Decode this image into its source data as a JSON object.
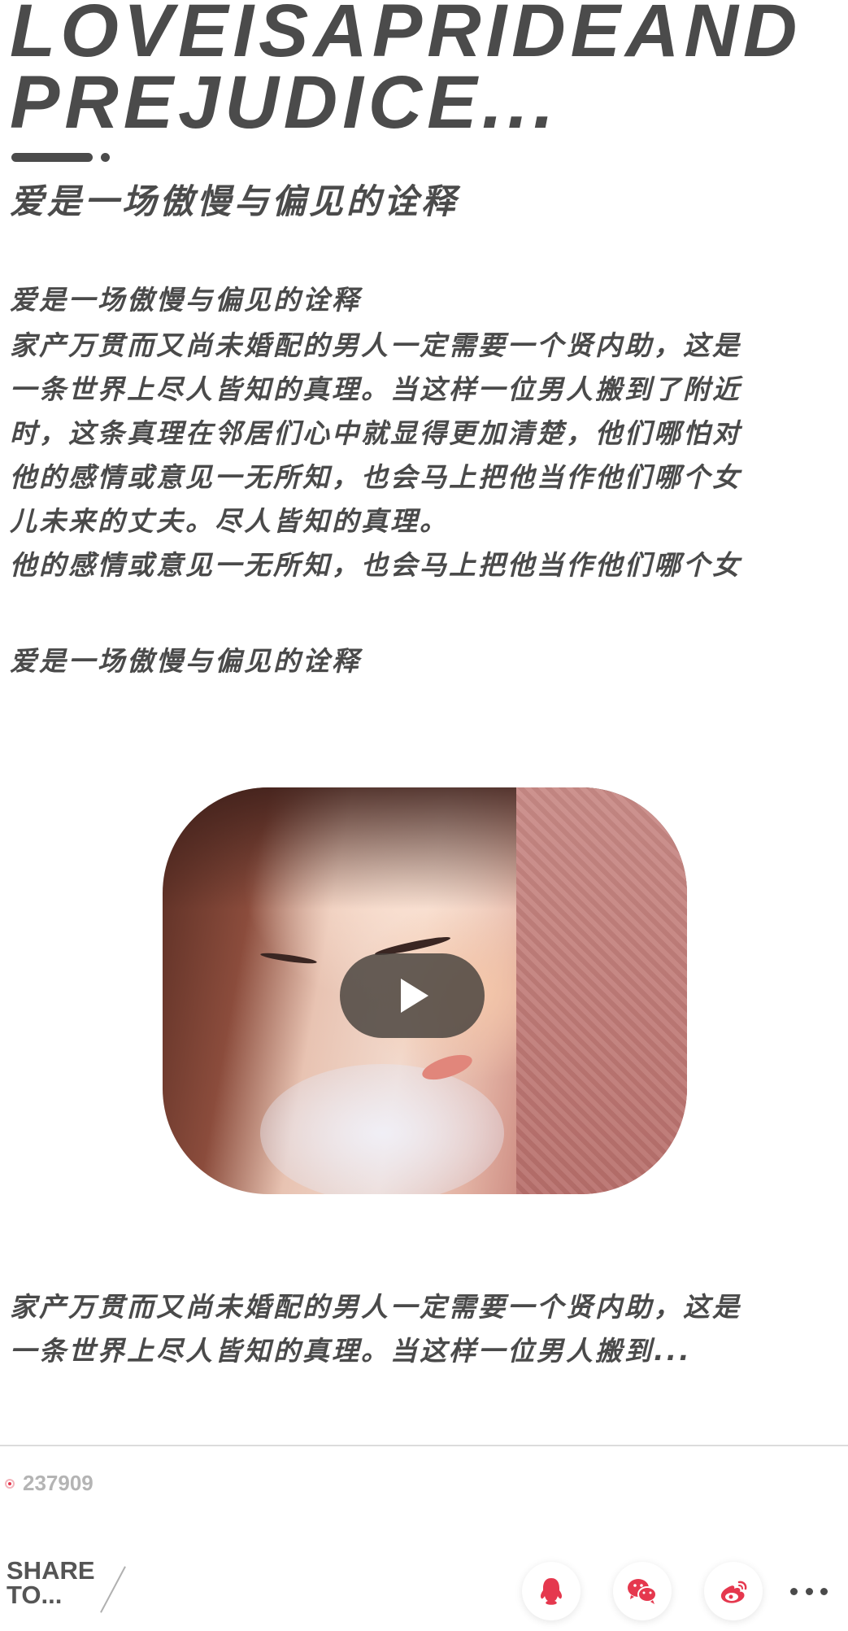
{
  "hero": {
    "title_line1": "LOVEISAPRIDEAND",
    "title_line2": "PREJUDICE...",
    "subtitle": "爱是一场傲慢与偏见的诠释"
  },
  "article": {
    "lede": "爱是一场傲慢与偏见的诠释",
    "paragraph_lines": [
      "家产万贯而又尚未婚配的男人一定需要一个贤内助，这是",
      "一条世界上尽人皆知的真理。当这样一位男人搬到了附近",
      "时，这条真理在邻居们心中就显得更加清楚，他们哪怕对",
      "他的感情或意见一无所知，也会马上把他当作他们哪个女",
      "儿未来的丈夫。尽人皆知的真理。",
      "他的感情或意见一无所知，也会马上把他当作他们哪个女"
    ],
    "caption": "爱是一场傲慢与偏见的诠释",
    "summary_lines": [
      "家产万贯而又尚未婚配的男人一定需要一个贤内助，这是",
      "一条世界上尽人皆知的真理。当这样一位男人搬到..."
    ]
  },
  "video": {
    "play_icon": "play-icon",
    "overlay_color": "#46413c"
  },
  "footer": {
    "views": "237909",
    "share_line1": "SHARE",
    "share_line2": "TO...",
    "share_targets": [
      "qq-icon",
      "wechat-icon",
      "weibo-icon"
    ],
    "more_icon": "more-icon",
    "accent_color": "#e5384e"
  }
}
